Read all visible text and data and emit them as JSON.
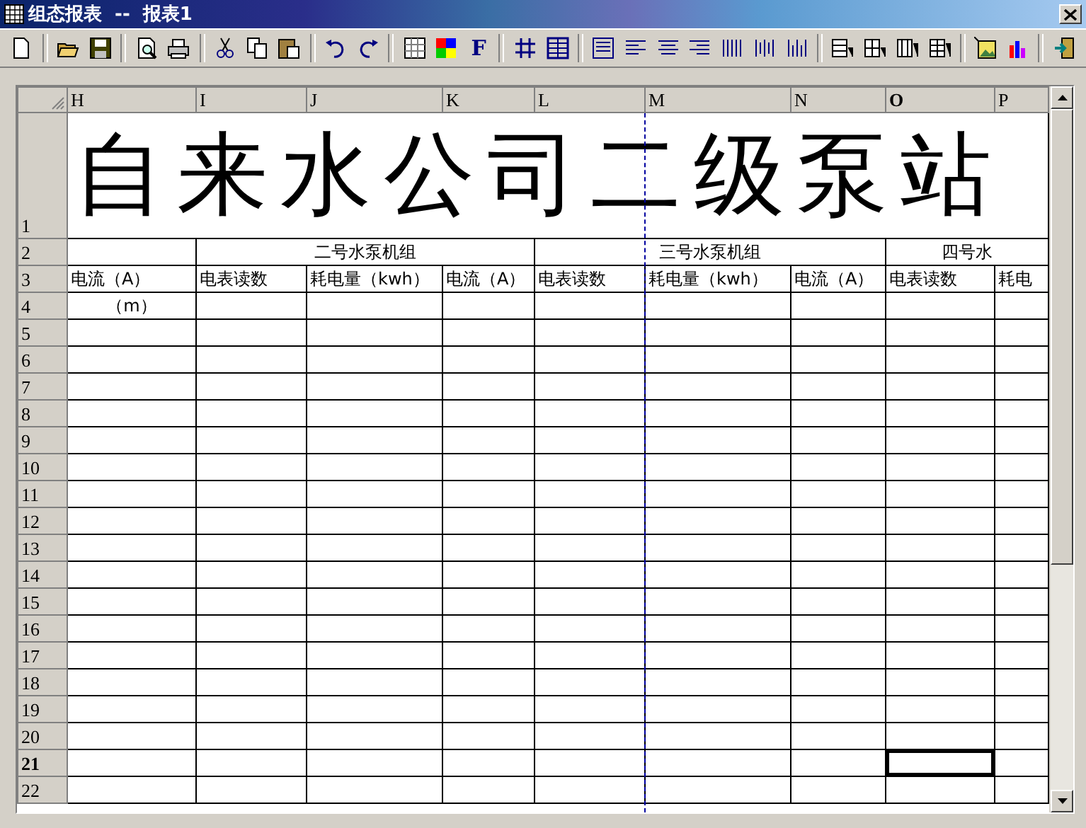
{
  "window": {
    "title": "组态报表  --  报表1"
  },
  "toolbar": {
    "font_button": "F"
  },
  "sheet": {
    "columns": [
      {
        "label": "H",
        "selected": false,
        "page_break": false
      },
      {
        "label": "I",
        "selected": false,
        "page_break": false
      },
      {
        "label": "J",
        "selected": false,
        "page_break": false
      },
      {
        "label": "K",
        "selected": false,
        "page_break": false
      },
      {
        "label": "L",
        "selected": false,
        "page_break": false
      },
      {
        "label": "M",
        "selected": false,
        "page_break": true
      },
      {
        "label": "N",
        "selected": false,
        "page_break": false
      },
      {
        "label": "O",
        "selected": true,
        "page_break": false
      },
      {
        "label": "P",
        "selected": false,
        "page_break": false
      }
    ],
    "title_row": {
      "label": "1",
      "selected": false,
      "text": "自来水公司二级泵站"
    },
    "group_row": {
      "label": "2",
      "selected": false,
      "cells": [
        {
          "kind": "empty"
        },
        {
          "kind": "merge_start",
          "text": "二号水泵机组"
        },
        {
          "kind": "merged"
        },
        {
          "kind": "merged"
        },
        {
          "kind": "merge_start",
          "text": "三号水泵机组"
        },
        {
          "kind": "merged"
        },
        {
          "kind": "merged"
        },
        {
          "kind": "merge_start",
          "text": "四号水"
        },
        {
          "kind": "merged"
        }
      ]
    },
    "rows": [
      {
        "label": "3",
        "selected": false,
        "cells": [
          "电流（A）",
          "电表读数",
          "耗电量（kwh）",
          "电流（A）",
          "电表读数",
          "耗电量（kwh）",
          "电流（A）",
          "电表读数",
          "耗电"
        ]
      },
      {
        "label": "4",
        "selected": false,
        "cells": [
          "（m）"
        ]
      },
      {
        "label": "5",
        "selected": false
      },
      {
        "label": "6",
        "selected": false
      },
      {
        "label": "7",
        "selected": false
      },
      {
        "label": "8",
        "selected": false
      },
      {
        "label": "9",
        "selected": false
      },
      {
        "label": "10",
        "selected": false
      },
      {
        "label": "11",
        "selected": false
      },
      {
        "label": "12",
        "selected": false
      },
      {
        "label": "13",
        "selected": false
      },
      {
        "label": "14",
        "selected": false
      },
      {
        "label": "15",
        "selected": false
      },
      {
        "label": "16",
        "selected": false
      },
      {
        "label": "17",
        "selected": false
      },
      {
        "label": "18",
        "selected": false
      },
      {
        "label": "19",
        "selected": false
      },
      {
        "label": "20",
        "selected": false
      },
      {
        "label": "21",
        "selected": true
      },
      {
        "label": "22",
        "selected": false
      }
    ]
  }
}
